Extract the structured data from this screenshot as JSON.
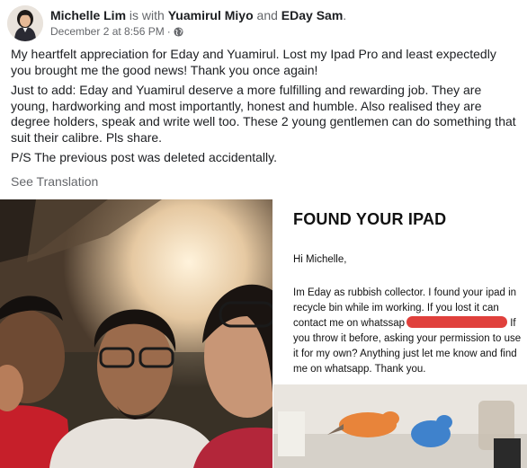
{
  "post": {
    "author": "Michelle Lim",
    "with_text": "is with",
    "tagged_1": "Yuamirul Miyo",
    "and_text": "and",
    "tagged_2": "EDay Sam",
    "date": "December 2 at 8:56 PM",
    "audience_icon": "globe-icon",
    "paragraphs": [
      "My heartfelt appreciation for Eday and Yuamirul.  Lost my Ipad Pro and least expectedly you brought me the good news! Thank you once again!",
      "Just to add: Eday and Yuamirul deserve a more fulfilling and rewarding job. They are young, hardworking and most importantly, honest and humble.  Also realised they are degree holders, speak and write well too.  These 2 young gentlemen can do something that suit their calibre.  Pls share.",
      "P/S The previous post was deleted accidentally."
    ],
    "see_translation": "See Translation"
  },
  "screenshot": {
    "title": "FOUND YOUR IPAD",
    "greeting": "Hi Michelle,",
    "body_before": "Im Eday as rubbish collector. I found your ipad in recycle bin while im working. If you lost it can contact me on whatssap",
    "body_after": " If you throw it before, asking your permission to use it for my own? Anything just let me know and find me on whatsapp. Thank you."
  },
  "colors": {
    "text": "#1c1e21",
    "secondary": "#65676b",
    "redaction": "#e0403c"
  }
}
